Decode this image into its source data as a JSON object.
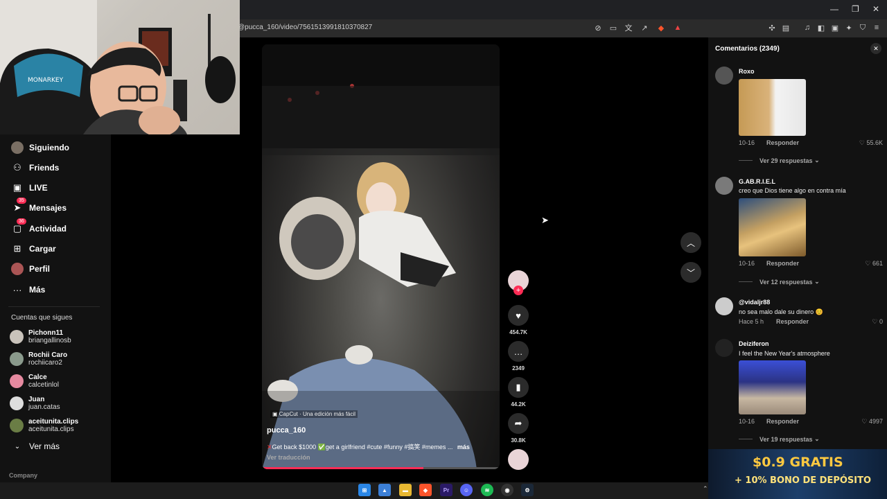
{
  "browser": {
    "url": "@pucca_160/video/7561513991810370827",
    "min": "—",
    "restore": "❐",
    "close": "✕"
  },
  "webcam": {
    "chair_brand": "MONARKEY"
  },
  "sidebar": {
    "items": [
      {
        "icon": "avatar-icon",
        "label": "Siguiendo"
      },
      {
        "icon": "friends-icon",
        "label": "Friends"
      },
      {
        "icon": "live-icon",
        "label": "LIVE"
      },
      {
        "icon": "messages-icon",
        "label": "Mensajes",
        "badge": "35"
      },
      {
        "icon": "activity-icon",
        "label": "Actividad",
        "badge": "36"
      },
      {
        "icon": "upload-icon",
        "label": "Cargar"
      },
      {
        "icon": "profile-icon",
        "label": "Perfil"
      },
      {
        "icon": "more-icon",
        "label": "Más"
      }
    ],
    "following_title": "Cuentas que sigues",
    "following": [
      {
        "name": "Pichonn11",
        "handle": "briangallinosb"
      },
      {
        "name": "Rochii Caro",
        "handle": "rochiicaro2"
      },
      {
        "name": "Calce",
        "handle": "calcetinlol"
      },
      {
        "name": "Juan",
        "handle": "juan.catas"
      },
      {
        "name": "aceitunita.clips",
        "handle": "aceitunita.clips"
      }
    ],
    "see_more": "Ver más",
    "company": "Company"
  },
  "video": {
    "capcut": "CapCut · Una edición más fácil",
    "author": "pucca_160",
    "caption": "Get back $1000 ✅get a girlfriend #cute #funny #搞笑 #memes ...",
    "more": "más",
    "translate": "Ver traducción",
    "progress": 0.68
  },
  "actions": {
    "likes": "454.7K",
    "comments": "2349",
    "saves": "44.2K",
    "shares": "30.8K"
  },
  "comments": {
    "title": "Comentarios (2349)",
    "reply_label": "Responder",
    "items": [
      {
        "user": "Roxo",
        "text": "",
        "date": "10-16",
        "likes": "55.6K",
        "replies": "Ver 29 respuestas"
      },
      {
        "user": "G.AB.R.I.E.L",
        "text": "creo que Dios tiene algo en contra mía",
        "date": "10-16",
        "likes": "661",
        "replies": "Ver 12 respuestas"
      },
      {
        "user": "@vidaljr88",
        "text": "no sea malo dale su dinero 😊",
        "date": "Hace 5 h",
        "likes": "0",
        "replies": ""
      },
      {
        "user": "Deiziferon",
        "text": "I feel the New Year's atmosphere",
        "date": "10-16",
        "likes": "4997",
        "replies": "Ver 19 respuestas"
      }
    ]
  },
  "ad": {
    "line1": "$0.9 GRATIS",
    "line2": "+ 10% BONO DE DEPÓSITO"
  },
  "taskbar": {
    "apps": [
      "windows",
      "photos",
      "explorer",
      "brave",
      "premiere",
      "discord",
      "spotify",
      "obs",
      "steam"
    ]
  },
  "colors": {
    "accent": "#fe2c55",
    "sidebar": "#121212",
    "panel": "#121212"
  }
}
